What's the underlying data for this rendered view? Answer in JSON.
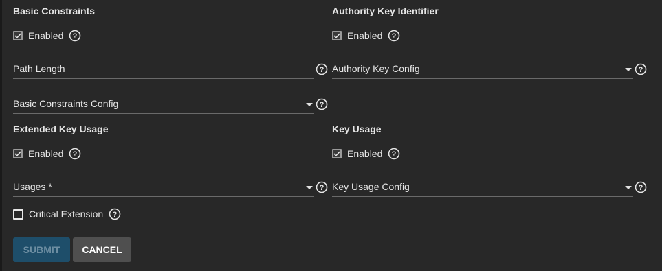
{
  "basic_constraints": {
    "heading": "Basic Constraints",
    "enabled_label": "Enabled",
    "path_length_label": "Path Length",
    "config_label": "Basic Constraints Config"
  },
  "authority_key_identifier": {
    "heading": "Authority Key Identifier",
    "enabled_label": "Enabled",
    "config_label": "Authority Key Config"
  },
  "extended_key_usage": {
    "heading": "Extended Key Usage",
    "enabled_label": "Enabled",
    "usages_label": "Usages *",
    "critical_label": "Critical Extension"
  },
  "key_usage": {
    "heading": "Key Usage",
    "enabled_label": "Enabled",
    "config_label": "Key Usage Config"
  },
  "buttons": {
    "submit": "SUBMIT",
    "cancel": "CANCEL"
  },
  "icons": {
    "help": "help-circle-icon",
    "check": "checkmark-icon",
    "dropdown": "dropdown-caret-icon"
  },
  "colors": {
    "background": "#282828",
    "submit_bg": "#1e4e6a",
    "cancel_bg": "#4f4f4f",
    "text": "#e6e6e6"
  }
}
